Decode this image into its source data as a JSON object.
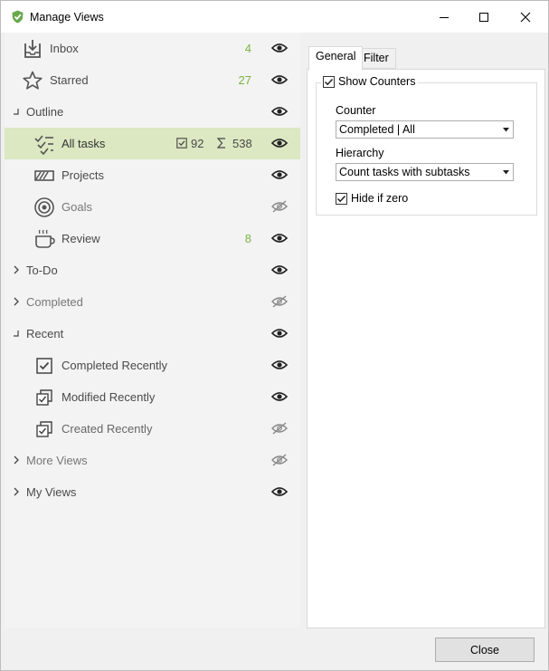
{
  "window": {
    "title": "Manage Views"
  },
  "views": [
    {
      "label": "Inbox",
      "count": "4",
      "visible": true,
      "icon": "inbox-icon"
    },
    {
      "label": "Starred",
      "count": "27",
      "visible": true,
      "icon": "star-icon"
    },
    {
      "label": "Outline",
      "visible": true,
      "expander": "expanded"
    },
    {
      "label": "All tasks",
      "visible": true,
      "icon": "all-tasks-icon",
      "selected": true,
      "completed_count": "92",
      "total_count": "538"
    },
    {
      "label": "Projects",
      "visible": true,
      "icon": "projects-icon"
    },
    {
      "label": "Goals",
      "visible": false,
      "icon": "target-icon"
    },
    {
      "label": "Review",
      "count": "8",
      "visible": true,
      "icon": "cup-icon"
    },
    {
      "label": "To-Do",
      "visible": true,
      "expander": "collapsed"
    },
    {
      "label": "Completed",
      "visible": false,
      "expander": "collapsed"
    },
    {
      "label": "Recent",
      "visible": true,
      "expander": "expanded"
    },
    {
      "label": "Completed Recently",
      "visible": true,
      "icon": "checked-box-icon"
    },
    {
      "label": "Modified Recently",
      "visible": true,
      "icon": "modified-icon"
    },
    {
      "label": "Created Recently",
      "visible": false,
      "icon": "created-icon"
    },
    {
      "label": "More Views",
      "visible": false,
      "expander": "collapsed"
    },
    {
      "label": "My Views",
      "visible": true,
      "expander": "collapsed"
    }
  ],
  "tabs": {
    "general": "General",
    "filter": "Filter"
  },
  "settings": {
    "show_counters_label": "Show Counters",
    "show_counters_checked": true,
    "counter_label": "Counter",
    "counter_value": "Completed | All",
    "hierarchy_label": "Hierarchy",
    "hierarchy_value": "Count tasks with subtasks",
    "hide_if_zero_label": "Hide if zero",
    "hide_if_zero_checked": true
  },
  "footer": {
    "close_label": "Close"
  },
  "colors": {
    "accent_green": "#7cb342",
    "selection": "#dbe8c2",
    "icon_gray": "#555555"
  }
}
